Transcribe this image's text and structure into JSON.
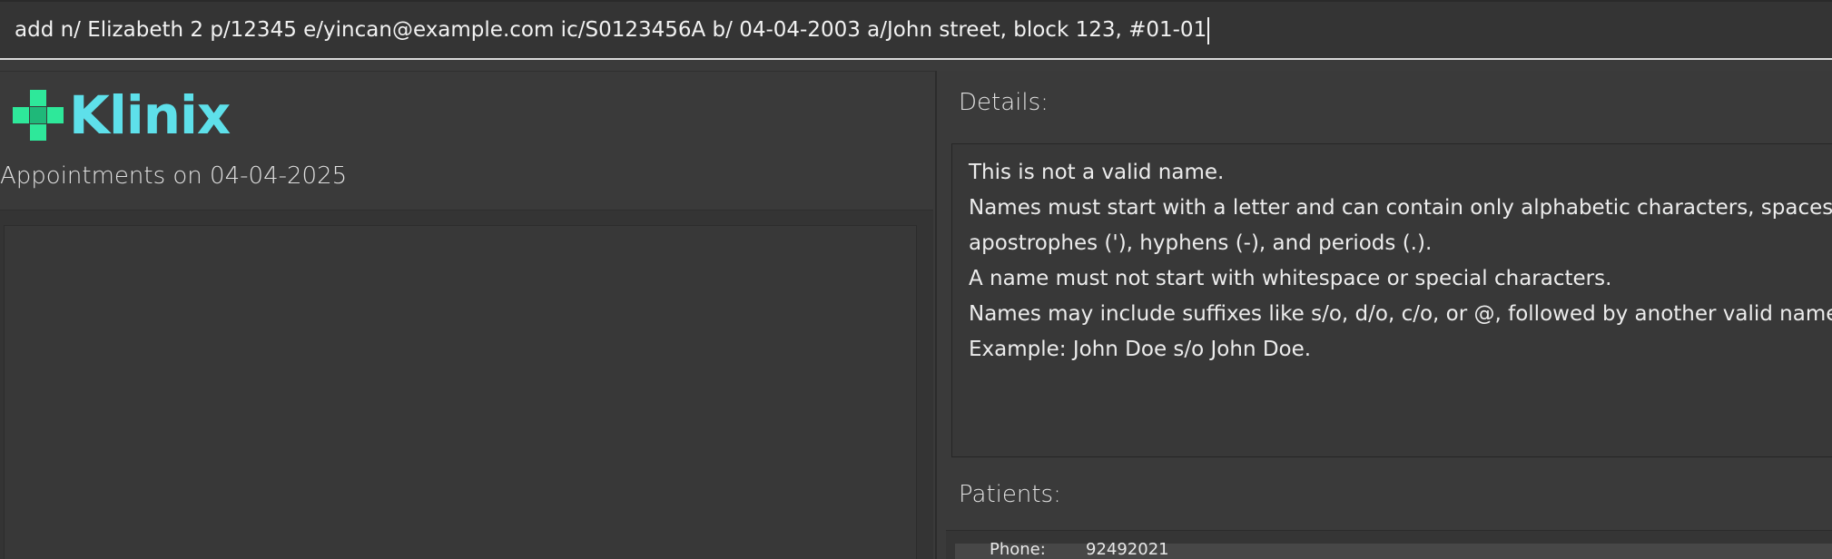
{
  "command": {
    "value": "add n/ Elizabeth 2 p/12345 e/yincan@example.com ic/S0123456A  b/ 04-04-2003 a/John street, block 123, #01-01"
  },
  "logo": {
    "text": "Klinix",
    "text_color": "#5ee0ea",
    "cross_color": "#2ee89a"
  },
  "appointments": {
    "title": "Appointments on 04-04-2025"
  },
  "details": {
    "title": "Details:",
    "lines": [
      "This is not a valid name.",
      "Names must start with a letter and can contain only alphabetic characters, spaces,",
      "apostrophes ('), hyphens (-), and periods (.).",
      "A name must not start with whitespace or special characters.",
      "Names may include suffixes like s/o, d/o, c/o, or @, followed by another valid name.",
      "Example: John Doe s/o John Doe."
    ]
  },
  "patients": {
    "title": "Patients:",
    "rows": [
      {
        "label": "Phone:",
        "value": "92492021"
      }
    ]
  }
}
